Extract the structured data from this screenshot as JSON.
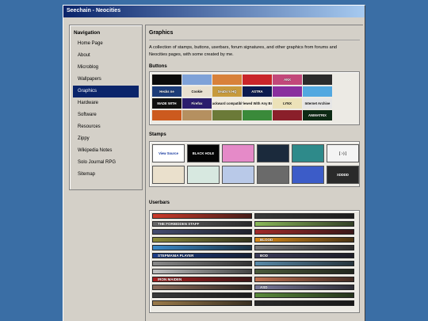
{
  "window": {
    "title": "Seechain - Neocities"
  },
  "nav": {
    "title": "Navigation",
    "items": [
      {
        "label": "Home Page",
        "active": false
      },
      {
        "label": "About",
        "active": false
      },
      {
        "label": "Microblog",
        "active": false
      },
      {
        "label": "Wallpapers",
        "active": false
      },
      {
        "label": "Graphics",
        "active": true
      },
      {
        "label": "Hardware",
        "active": false
      },
      {
        "label": "Software",
        "active": false
      },
      {
        "label": "Resources",
        "active": false
      },
      {
        "label": "Zippy",
        "active": false
      },
      {
        "label": "Wikipedia Notes",
        "active": false
      },
      {
        "label": "Solo Journal RPG",
        "active": false
      },
      {
        "label": "Sitemap",
        "active": false
      }
    ]
  },
  "main": {
    "title": "Graphics",
    "intro": "A collection of stamps, buttons, userbars, forum signatures, and other graphics from forums and Neocities pages, with some created by me.",
    "buttons_heading": "Buttons",
    "stamps_heading": "Stamps",
    "userbars_heading": "Userbars"
  },
  "buttons": [
    {
      "text": "",
      "bg": "#0b0b0b"
    },
    {
      "text": "",
      "bg": "#7fa2d8"
    },
    {
      "text": "",
      "bg": "#d8813a"
    },
    {
      "text": "",
      "bg": "#c9252a"
    },
    {
      "text": "ANX",
      "bg": "#c2487a"
    },
    {
      "text": "",
      "bg": "#2b2b2b"
    },
    {
      "text": "Hecks ne",
      "bg": "#1c3c78"
    },
    {
      "text": "Cookie",
      "bg": "#e8e0d0"
    },
    {
      "text": "SeaDo's HQ",
      "bg": "#c79a3d"
    },
    {
      "text": "ASTRA",
      "bg": "#0c1a4f"
    },
    {
      "text": "",
      "bg": "#8a2f9e"
    },
    {
      "text": "",
      "bg": "#52a8e0"
    },
    {
      "text": "MADE WITH",
      "bg": "#101010"
    },
    {
      "text": "Firefox",
      "bg": "#2a1d6d"
    },
    {
      "text": "backward compatible",
      "bg": "#f1ece0"
    },
    {
      "text": "Best Viewed With Any Browser",
      "bg": "#f4efe0"
    },
    {
      "text": "LYNX",
      "bg": "#ece2b8"
    },
    {
      "text": "Internet Archive",
      "bg": "#e6e6e6"
    },
    {
      "text": "",
      "bg": "#cc5a1e"
    },
    {
      "text": "",
      "bg": "#b59060"
    },
    {
      "text": "",
      "bg": "#6b7a38"
    },
    {
      "text": "",
      "bg": "#3a8a3a"
    },
    {
      "text": "",
      "bg": "#8a1f2a"
    },
    {
      "text": "ANIMATRIX",
      "bg": "#0d2a14"
    }
  ],
  "stamps": [
    {
      "text": "View Source",
      "bg": "#ffffff",
      "fg": "#1a3ca0"
    },
    {
      "text": "BLACK HOLE",
      "bg": "#050505",
      "fg": "#ffffff"
    },
    {
      "text": "",
      "bg": "#e58ac8",
      "fg": "#ffffff"
    },
    {
      "text": "",
      "bg": "#1b2a3c",
      "fg": "#ffffff"
    },
    {
      "text": "",
      "bg": "#2e8a8a",
      "fg": "#ffffff"
    },
    {
      "text": "[ :-) ]",
      "bg": "#f4f4f4",
      "fg": "#222222"
    },
    {
      "text": "",
      "bg": "#eae0cc",
      "fg": "#c41a1a"
    },
    {
      "text": "",
      "bg": "#d7e8e0",
      "fg": "#222222"
    },
    {
      "text": "",
      "bg": "#b9c9e8",
      "fg": "#222222"
    },
    {
      "text": "",
      "bg": "#6a6a6a",
      "fg": "#ffffff"
    },
    {
      "text": "",
      "bg": "#3c5cc8",
      "fg": "#ffffff"
    },
    {
      "text": "XDDDD",
      "bg": "#2a2a2a",
      "fg": "#ffffff"
    }
  ],
  "userbars": [
    {
      "text": "",
      "bg": "#cc3a2a"
    },
    {
      "text": "",
      "bg": "#3a3a3a"
    },
    {
      "text": "THE FORBIDDEN STAFF",
      "bg": "#6a6a6a"
    },
    {
      "text": "",
      "bg": "#8ab85a"
    },
    {
      "text": "",
      "bg": "#444c70"
    },
    {
      "text": "",
      "bg": "#a02a2a"
    },
    {
      "text": "",
      "bg": "#8a8a3a"
    },
    {
      "text": "BLOOD",
      "bg": "#d88a1a"
    },
    {
      "text": "",
      "bg": "#3a8ac8"
    },
    {
      "text": "",
      "bg": "#7a7a7a"
    },
    {
      "text": "STEPMANIA PLAYER",
      "bg": "#1c3e8a"
    },
    {
      "text": "BOD",
      "bg": "#3a3a5a"
    },
    {
      "text": "",
      "bg": "#8a8a8a"
    },
    {
      "text": "",
      "bg": "#5a8aa8"
    },
    {
      "text": "",
      "bg": "#c0c0c0"
    },
    {
      "text": "",
      "bg": "#4a5a3a"
    },
    {
      "text": "IRON MAIDEN",
      "bg": "#aa2020"
    },
    {
      "text": "",
      "bg": "#c07050"
    },
    {
      "text": "",
      "bg": "#8a6a5a"
    },
    {
      "text": "ASD",
      "bg": "#7a7a9a"
    },
    {
      "text": "",
      "bg": "#3a3a3a"
    },
    {
      "text": "",
      "bg": "#5a8a3a"
    },
    {
      "text": "",
      "bg": "#9a7a4a"
    },
    {
      "text": "",
      "bg": "#2a2a2a"
    }
  ]
}
